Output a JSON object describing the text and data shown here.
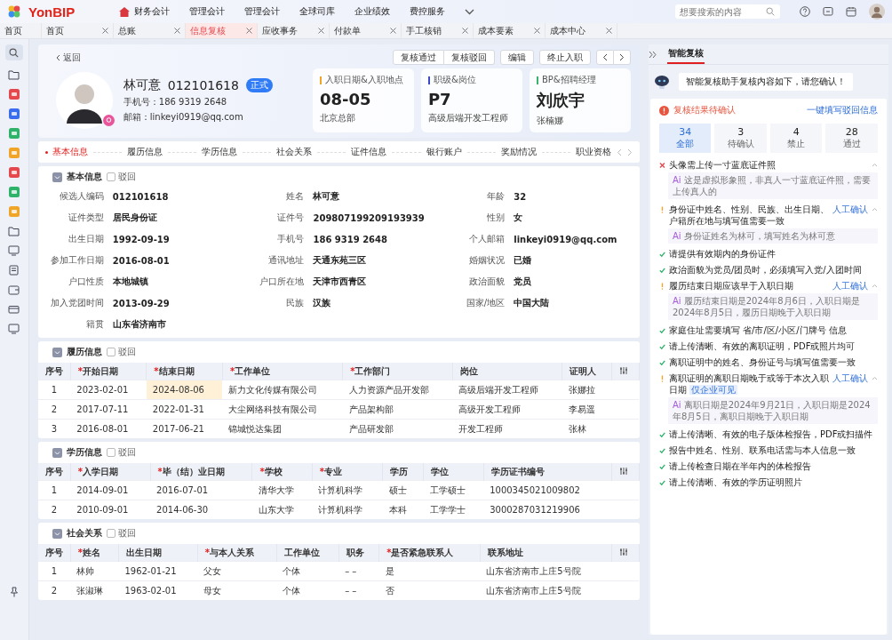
{
  "app": {
    "logo": "YonBIP",
    "menu": [
      {
        "label": "财务会计",
        "home": true
      },
      {
        "label": "管理会计",
        "home": false
      },
      {
        "label": "管理会计",
        "home": false
      },
      {
        "label": "全球司库",
        "home": false
      },
      {
        "label": "企业绩效",
        "home": false
      },
      {
        "label": "费控服务",
        "home": false
      }
    ],
    "search": {
      "placeholder": "想要搜索的内容"
    }
  },
  "tabs": [
    {
      "label": "首页",
      "selected": false,
      "closable": false
    },
    {
      "label": "首页",
      "selected": false,
      "closable": true
    },
    {
      "label": "总账",
      "selected": false,
      "closable": true
    },
    {
      "label": "信息复核",
      "selected": true,
      "closable": true
    },
    {
      "label": "应收事务",
      "selected": false,
      "closable": true
    },
    {
      "label": "付款单",
      "selected": false,
      "closable": true
    },
    {
      "label": "手工核销",
      "selected": false,
      "closable": true
    },
    {
      "label": "成本要素",
      "selected": false,
      "closable": true
    },
    {
      "label": "成本中心",
      "selected": false,
      "closable": true
    }
  ],
  "back": "返回",
  "actions": [
    "复核通过",
    "复核驳回",
    "编辑",
    "终止入职"
  ],
  "profile": {
    "name": "林可意",
    "code": "012101618",
    "status": "正式",
    "phone": "手机号：186 9319 2648",
    "email": "邮箱：linkeyi0919@qq.com"
  },
  "cards": [
    {
      "label": "入职日期&入职地点",
      "value": "08-05",
      "sub": "北京总部",
      "color": "#f0a428"
    },
    {
      "label": "职级&岗位",
      "value": "P7",
      "sub": "高级后端开发工程师",
      "color": "#3b4bc8"
    },
    {
      "label": "BP&招聘经理",
      "value": "刘欣宇",
      "sub": "张楠娜",
      "color": "#3bb36a"
    }
  ],
  "anchors": [
    {
      "label": "基本信息",
      "selected": true
    },
    {
      "label": "履历信息",
      "selected": false
    },
    {
      "label": "学历信息",
      "selected": false
    },
    {
      "label": "社会关系",
      "selected": false
    },
    {
      "label": "证件信息",
      "selected": false
    },
    {
      "label": "银行账户",
      "selected": false
    },
    {
      "label": "奖励情况",
      "selected": false
    },
    {
      "label": "职业资格",
      "selected": false
    }
  ],
  "basic": {
    "title": "基本信息",
    "reject_label": "驳回",
    "reject_checked": false,
    "fields": [
      {
        "label": "候选人编码",
        "value": "012101618"
      },
      {
        "label": "姓名",
        "value": "林可意"
      },
      {
        "label": "年龄",
        "value": "32"
      },
      {
        "label": "证件类型",
        "value": "居民身份证"
      },
      {
        "label": "证件号",
        "value": "209807199209193939"
      },
      {
        "label": "性别",
        "value": "女"
      },
      {
        "label": "出生日期",
        "value": "1992-09-19"
      },
      {
        "label": "手机号",
        "value": "186 9319 2648"
      },
      {
        "label": "个人邮箱",
        "value": "linkeyi0919@qq.com"
      },
      {
        "label": "参加工作日期",
        "value": "2016-08-01"
      },
      {
        "label": "通讯地址",
        "value": "天通东苑三区"
      },
      {
        "label": "婚姻状况",
        "value": "已婚"
      },
      {
        "label": "户口性质",
        "value": "本地城镇"
      },
      {
        "label": "户口所在地",
        "value": "天津市西青区"
      },
      {
        "label": "政治面貌",
        "value": "党员"
      },
      {
        "label": "加入党团时间",
        "value": "2013-09-29"
      },
      {
        "label": "民族",
        "value": "汉族"
      },
      {
        "label": "国家/地区",
        "value": "中国大陆"
      },
      {
        "label": "籍贯",
        "value": "山东省济南市"
      }
    ]
  },
  "tables": [
    {
      "title": "履历信息",
      "reject_label": "驳回",
      "reject_checked": false,
      "columns": [
        {
          "label": "序号"
        },
        {
          "mark": "*",
          "label": "开始日期"
        },
        {
          "mark": "*",
          "label": "结束日期"
        },
        {
          "mark": "*",
          "label": "工作单位"
        },
        {
          "mark": "*",
          "label": "工作部门"
        },
        {
          "label": "岗位"
        },
        {
          "label": "证明人"
        }
      ],
      "rows": [
        [
          "1",
          "2023-02-01",
          {
            "text": "2024-08-06",
            "highlighted": true
          },
          "新力文化传媒有限公司",
          "人力资源产品开发部",
          "高级后端开发工程师",
          "张娜拉"
        ],
        [
          "2",
          "2017-07-11",
          "2022-01-31",
          "大尘网络科技有限公司",
          "产品架构部",
          "高级开发工程师",
          "李易遥"
        ],
        [
          "3",
          "2016-08-01",
          "2017-06-21",
          "锦城悦达集团",
          "产品研发部",
          "开发工程师",
          "张林"
        ]
      ]
    },
    {
      "title": "学历信息",
      "reject_label": "驳回",
      "reject_checked": false,
      "columns": [
        {
          "label": "序号"
        },
        {
          "mark": "*",
          "label": "入学日期"
        },
        {
          "mark": "*",
          "label": "毕（结）业日期"
        },
        {
          "mark": "*",
          "label": "学校"
        },
        {
          "mark": "*",
          "label": "专业"
        },
        {
          "label": "学历"
        },
        {
          "label": "学位"
        },
        {
          "label": "学历证书编号"
        }
      ],
      "rows": [
        [
          "1",
          "2014-09-01",
          "2016-07-01",
          "清华大学",
          "计算机科学",
          "硕士",
          "工学硕士",
          "1000345021009802"
        ],
        [
          "2",
          "2010-09-01",
          "2014-06-30",
          "山东大学",
          "计算机科学",
          "本科",
          "工学学士",
          "3000287031219906"
        ]
      ]
    },
    {
      "title": "社会关系",
      "reject_label": "驳回",
      "reject_checked": false,
      "columns": [
        {
          "label": "序号"
        },
        {
          "mark": "*",
          "label": "姓名"
        },
        {
          "label": "出生日期"
        },
        {
          "mark": "*",
          "label": "与本人关系"
        },
        {
          "label": "工作单位"
        },
        {
          "label": "职务"
        },
        {
          "mark": "*",
          "label": "是否紧急联系人"
        },
        {
          "label": "联系地址"
        }
      ],
      "rows": [
        [
          "1",
          "林帅",
          "1962-01-21",
          "父女",
          "个体",
          "– –",
          "是",
          "山东省济南市上庄5号院"
        ],
        [
          "2",
          "张淑琳",
          "1963-02-01",
          "母女",
          "个体",
          "– –",
          "否",
          "山东省济南市上庄5号院"
        ]
      ]
    }
  ],
  "review": {
    "tab": "智能复核",
    "assistant_message": "智能复核助手复核内容如下，请您确认！",
    "status": "复核结果待确认",
    "fill_link": "一键填写驳回信息",
    "stats": [
      {
        "count": "34",
        "label": "全部",
        "selected": true
      },
      {
        "count": "3",
        "label": "待确认",
        "selected": false
      },
      {
        "count": "4",
        "label": "禁止",
        "selected": false
      },
      {
        "count": "28",
        "label": "通过",
        "selected": false
      }
    ],
    "items": [
      {
        "kind": "error",
        "text": "头像需上传一寸蓝底证件照",
        "expanded": true,
        "note": {
          "badge": "Ai",
          "text": "这是虚拟形象照，非真人一寸蓝底证件照，需要上传真人的"
        }
      },
      {
        "kind": "warning",
        "text": "身份证中姓名、性别、民族、出生日期、户籍所在地与填写值需要一致",
        "action": "人工确认",
        "expanded": true,
        "note": {
          "badge": "Ai",
          "text": "身份证姓名为林可，填写姓名为林可意"
        }
      },
      {
        "kind": "pass",
        "text": "请提供有效期内的身份证件"
      },
      {
        "kind": "pass",
        "text": "政治面貌为党员/团员时，必须填写入党/入团时间"
      },
      {
        "kind": "warning",
        "text": "履历结束日期应该早于入职日期",
        "action": "人工确认",
        "expanded": true,
        "note": {
          "badge": "Ai",
          "text": "履历结束日期是2024年8月6日，入职日期是2024年8月5日，履历日期晚于入职日期"
        }
      },
      {
        "kind": "pass",
        "text": "家庭住址需要填写 省/市/区/小区/门牌号 信息"
      },
      {
        "kind": "pass",
        "text": "请上传清晰、有效的离职证明，PDF或照片均可"
      },
      {
        "kind": "pass",
        "text": "离职证明中的姓名、身份证号与填写值需要一致"
      },
      {
        "kind": "warning",
        "text": "离职证明的离职日期晚于或等于本次入职日期",
        "tag": "仅企业可见",
        "action": "人工确认",
        "expanded": true,
        "note": {
          "badge": "Ai",
          "text": "离职日期是2024年9月21日，入职日期是2024年8月5日，离职日期晚于入职日期"
        }
      },
      {
        "kind": "pass",
        "text": "请上传清晰、有效的电子版体检报告，PDF或扫描件"
      },
      {
        "kind": "pass",
        "text": "报告中姓名、性别、联系电话需与本人信息一致"
      },
      {
        "kind": "pass",
        "text": "请上传检查日期在半年内的体检报告"
      },
      {
        "kind": "pass",
        "text": "请上传清晰、有效的学历证明照片"
      }
    ]
  }
}
